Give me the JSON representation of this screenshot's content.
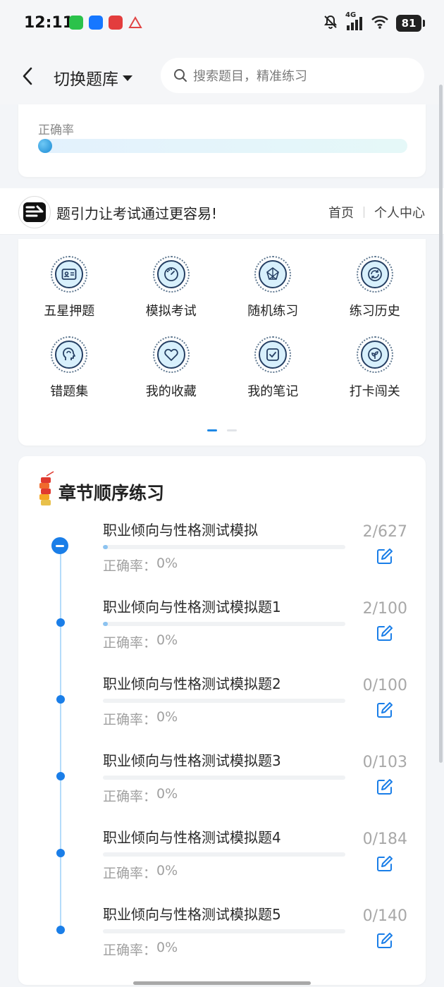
{
  "status": {
    "time": "12:11",
    "network": "4G",
    "battery": "81",
    "app_icons": [
      {
        "name": "wechat-icon",
        "color": "#2bc24b"
      },
      {
        "name": "app-shield-icon",
        "color": "#1677ff"
      },
      {
        "name": "app-red-icon",
        "color": "#e33d3d"
      },
      {
        "name": "app-mountain-icon",
        "color": "#e04545"
      }
    ]
  },
  "header": {
    "bank_label": "切换题库",
    "search_placeholder": "搜索题目，精准练习"
  },
  "rate": {
    "label": "正确率",
    "value_fraction": 0
  },
  "banner": {
    "slogan": "题引力让考试通过更容易!",
    "nav": [
      "首页",
      "个人中心"
    ]
  },
  "menu": {
    "items": [
      {
        "label": "五星押题",
        "icon": "id-card-icon"
      },
      {
        "label": "模拟考试",
        "icon": "gauge-icon"
      },
      {
        "label": "随机练习",
        "icon": "shuffle-icon"
      },
      {
        "label": "练习历史",
        "icon": "history-icon"
      },
      {
        "label": "错题集",
        "icon": "head-icon"
      },
      {
        "label": "我的收藏",
        "icon": "heart-icon"
      },
      {
        "label": "我的笔记",
        "icon": "note-icon"
      },
      {
        "label": "打卡闯关",
        "icon": "leaf-icon"
      }
    ],
    "pages": 2,
    "current_page": 1
  },
  "chapter": {
    "title": "章节顺序练习",
    "rate_label": "正确率：",
    "items": [
      {
        "title": "职业倾向与性格测试模拟",
        "done": 2,
        "total": 627,
        "count": "2/627",
        "rate": "0%"
      },
      {
        "title": "职业倾向与性格测试模拟题1",
        "done": 2,
        "total": 100,
        "count": "2/100",
        "rate": "0%"
      },
      {
        "title": "职业倾向与性格测试模拟题2",
        "done": 0,
        "total": 100,
        "count": "0/100",
        "rate": "0%"
      },
      {
        "title": "职业倾向与性格测试模拟题3",
        "done": 0,
        "total": 103,
        "count": "0/103",
        "rate": "0%"
      },
      {
        "title": "职业倾向与性格测试模拟题4",
        "done": 0,
        "total": 184,
        "count": "0/184",
        "rate": "0%"
      },
      {
        "title": "职业倾向与性格测试模拟题5",
        "done": 0,
        "total": 140,
        "count": "0/140",
        "rate": "0%"
      }
    ]
  },
  "colors": {
    "accent": "#1a7ee8",
    "progress": "#8cc3f0"
  }
}
